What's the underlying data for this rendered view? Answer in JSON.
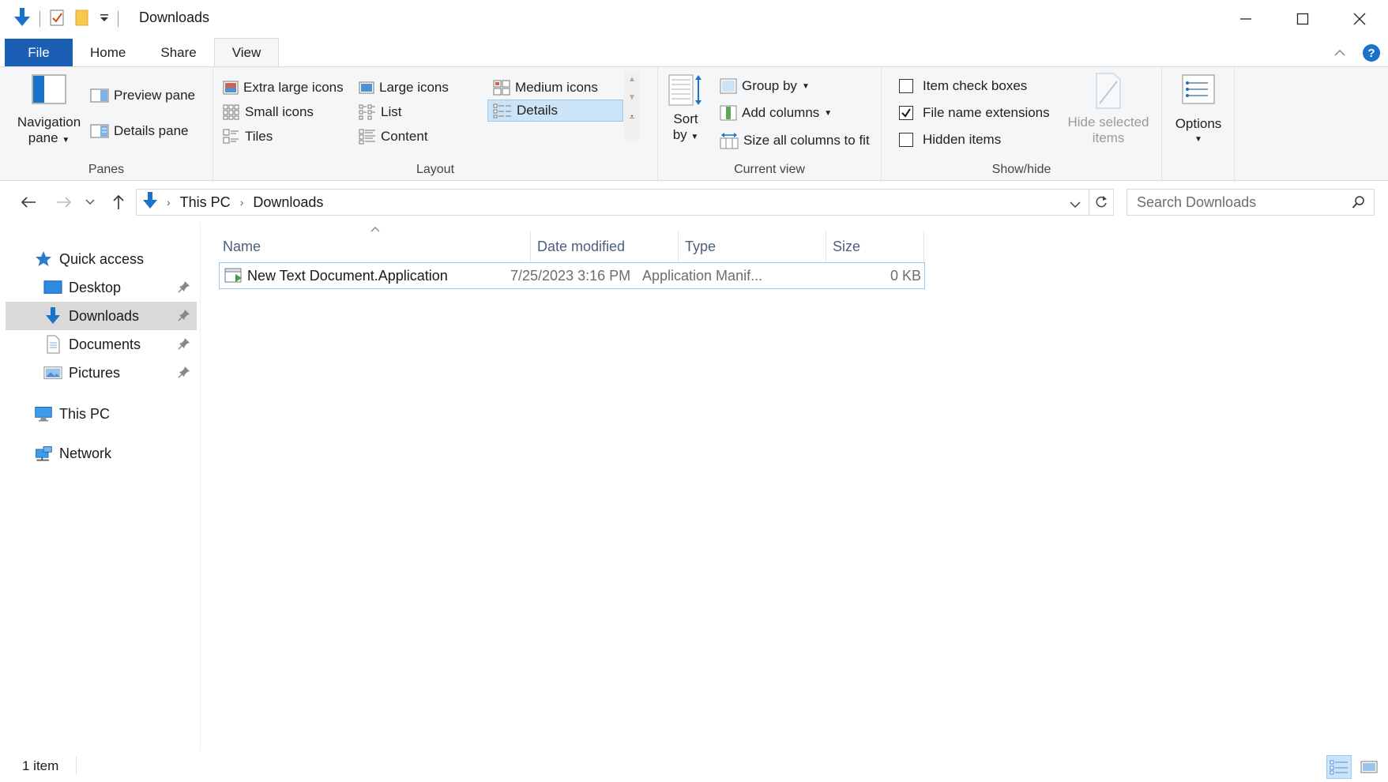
{
  "window": {
    "title": "Downloads",
    "controls": {
      "minimize": "minimize-icon",
      "maximize": "maximize-icon",
      "close": "close-icon"
    }
  },
  "ribbon": {
    "tabs": [
      {
        "label": "File"
      },
      {
        "label": "Home"
      },
      {
        "label": "Share"
      },
      {
        "label": "View"
      }
    ],
    "panes": {
      "label": "Panes",
      "navigation_pane_line1": "Navigation",
      "navigation_pane_line2": "pane",
      "preview_pane": "Preview pane",
      "details_pane": "Details pane"
    },
    "layout": {
      "label": "Layout",
      "items": [
        {
          "label": "Extra large icons"
        },
        {
          "label": "Large icons"
        },
        {
          "label": "Medium icons"
        },
        {
          "label": "Small icons"
        },
        {
          "label": "List"
        },
        {
          "label": "Details"
        },
        {
          "label": "Tiles"
        },
        {
          "label": "Content"
        }
      ],
      "selected": "Details"
    },
    "current_view": {
      "label": "Current view",
      "sort_by_line1": "Sort",
      "sort_by_line2": "by",
      "group_by": "Group by",
      "add_columns": "Add columns",
      "size_all_columns": "Size all columns to fit"
    },
    "show_hide": {
      "label": "Show/hide",
      "item_check_boxes": {
        "label": "Item check boxes",
        "checked": false
      },
      "file_name_extensions": {
        "label": "File name extensions",
        "checked": true
      },
      "hidden_items": {
        "label": "Hidden items",
        "checked": false
      },
      "hide_selected_line1": "Hide selected",
      "hide_selected_line2": "items"
    },
    "options": {
      "label": "Options"
    }
  },
  "address": {
    "segments": [
      "This PC",
      "Downloads"
    ],
    "search_placeholder": "Search Downloads"
  },
  "nav_pane": {
    "quick_access": "Quick access",
    "pinned": [
      {
        "label": "Desktop"
      },
      {
        "label": "Downloads"
      },
      {
        "label": "Documents"
      },
      {
        "label": "Pictures"
      }
    ],
    "this_pc": "This PC",
    "network": "Network",
    "selected": "Downloads"
  },
  "file_list": {
    "columns": [
      "Name",
      "Date modified",
      "Type",
      "Size"
    ],
    "rows": [
      {
        "name": "New Text Document.Application",
        "date": "7/25/2023 3:16 PM",
        "type": "Application Manif...",
        "size": "0 KB"
      }
    ]
  },
  "status": {
    "item_count": "1 item"
  },
  "colors": {
    "file_tab": "#1a5fb4",
    "selection": "#cce4f7",
    "selection_border": "#99c9ef",
    "header_text": "#4c607a"
  }
}
